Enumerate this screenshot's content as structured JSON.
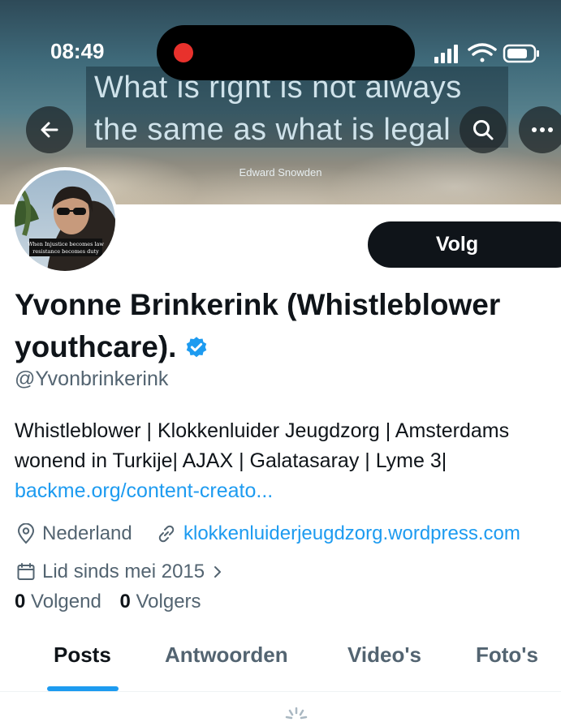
{
  "status_bar": {
    "time": "08:49"
  },
  "banner": {
    "quote_line1": "What is right is not always",
    "quote_line2": "the same as what is legal",
    "quote_author": "Edward Snowden"
  },
  "avatar": {
    "caption_line1": "When Injustice becomes law",
    "caption_line2": "resistance becomes duty"
  },
  "profile": {
    "follow_label": "Volg",
    "name_line1": "Yvonne Brinkerink (Whistleblower",
    "name_line2": "youthcare).",
    "handle": "@Yvonbrinkerink",
    "bio_line1": "Whistleblower | Klokkenluider Jeugdzorg | Amsterdams",
    "bio_line2": "wonend in Turkije| AJAX | Galatasaray | Lyme 3|",
    "bio_link": "backme.org/content-creato...",
    "location": "Nederland",
    "website": "klokkenluiderjeugdzorg.wordpress.com",
    "joined": "Lid sinds mei 2015",
    "following_count": "0",
    "following_label": "Volgend",
    "followers_count": "0",
    "followers_label": "Volgers"
  },
  "tabs": [
    {
      "label": "Posts",
      "active": true
    },
    {
      "label": "Antwoorden",
      "active": false
    },
    {
      "label": "Video's",
      "active": false
    },
    {
      "label": "Foto's",
      "active": false
    }
  ],
  "colors": {
    "accent": "#1d9bf0",
    "text": "#0f1419",
    "secondary": "#536471",
    "record": "#e8312c"
  }
}
